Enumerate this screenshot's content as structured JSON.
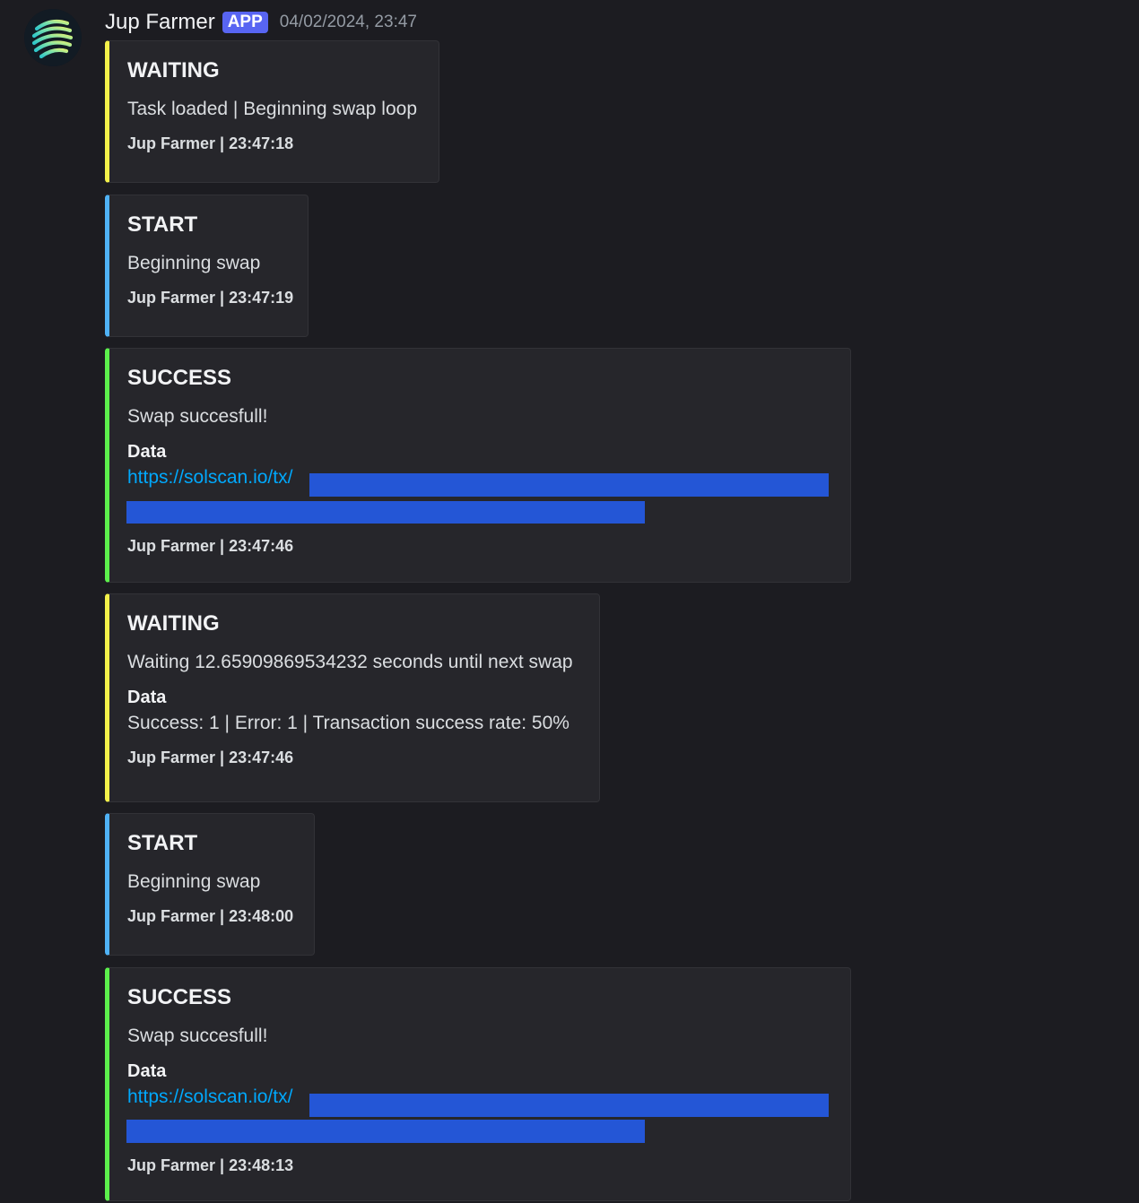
{
  "message": {
    "username": "Jup Farmer",
    "badge": "APP",
    "timestamp": "04/02/2024, 23:47"
  },
  "colors": {
    "waiting": "#f3f14a",
    "start": "#4fb2f6",
    "success": "#5cf04c",
    "link": "#00a8fc",
    "redaction": "#2456d6"
  },
  "embeds": [
    {
      "status": "waiting",
      "title": "WAITING",
      "description": "Task loaded | Beginning swap loop",
      "footer": "Jup Farmer | 23:47:18"
    },
    {
      "status": "start",
      "title": "START",
      "description": "Beginning swap",
      "footer": "Jup Farmer | 23:47:19"
    },
    {
      "status": "success",
      "title": "SUCCESS",
      "description": "Swap succesfull!",
      "field_name": "Data",
      "field_link": "https://solscan.io/tx/",
      "footer": "Jup Farmer | 23:47:46"
    },
    {
      "status": "waiting",
      "title": "WAITING",
      "description": "Waiting 12.65909869534232 seconds until next swap",
      "field_name": "Data",
      "field_value": "Success: 1 | Error: 1 | Transaction success rate: 50%",
      "footer": "Jup Farmer | 23:47:46"
    },
    {
      "status": "start",
      "title": "START",
      "description": "Beginning swap",
      "footer": "Jup Farmer | 23:48:00"
    },
    {
      "status": "success",
      "title": "SUCCESS",
      "description": "Swap succesfull!",
      "field_name": "Data",
      "field_link": "https://solscan.io/tx/",
      "footer": "Jup Farmer | 23:48:13"
    }
  ]
}
